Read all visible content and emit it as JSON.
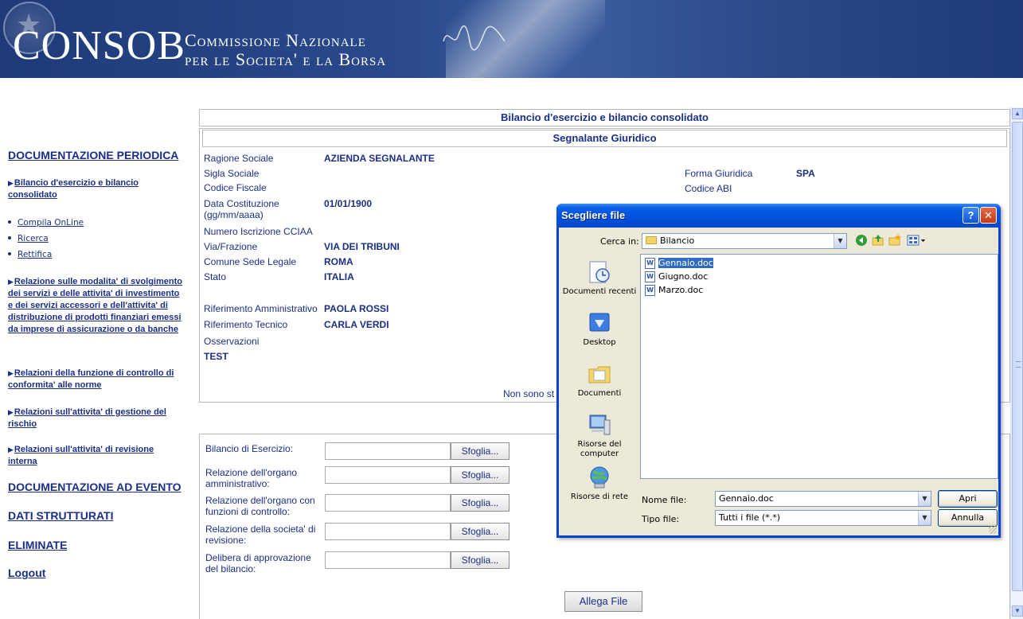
{
  "header": {
    "brand": "CONSOB",
    "tagline_line1": "Commissione Nazionale",
    "tagline_line2": "per le Societa' e la Borsa",
    "colors": {
      "banner": "#2a4a8c",
      "text": "#ffffff"
    }
  },
  "nav": {
    "documentazione_periodica": "DOCUMENTAZIONE PERIODICA",
    "bilancio": "Bilancio d'esercizio e bilancio consolidato",
    "compila": "Compila OnLine",
    "ricerca": "Ricerca",
    "rettifica": "Rettifica",
    "relazione_modalita": "Relazione sulle modalita' di svolgimento dei servizi e delle attivita' di investimento e dei servizi accessori e dell'attivita' di distribuzione di prodotti finanziari emessi da imprese di assicurazione o da banche",
    "relazioni_conformita": "Relazioni della funzione di controllo di conformita' alle norme",
    "relazioni_rischio": "Relazioni sull'attivita' di gestione del rischio",
    "relazioni_revisione": "Relazioni sull'attivita' di revisione interna",
    "documentazione_evento": "DOCUMENTAZIONE AD EVENTO",
    "dati_strutturati": "DATI STRUTTURATI",
    "eliminate": "ELIMINATE",
    "logout": "Logout",
    "colors": {
      "link": "#1a2f86"
    }
  },
  "main": {
    "page_title": "Bilancio d'esercizio e bilancio consolidato",
    "section_title": "Segnalante Giuridico",
    "fields": {
      "ragione_sociale_label": "Ragione Sociale",
      "ragione_sociale_value": "AZIENDA SEGNALANTE",
      "sigla_label": "Sigla Sociale",
      "codice_fiscale_label": "Codice Fiscale",
      "data_costituzione_label": "Data Costituzione (gg/mm/aaaa)",
      "data_costituzione_value": "01/01/1900",
      "numero_cciaa_label": "Numero Iscrizione CCIAA",
      "via_label": "Via/Frazione",
      "via_value": "VIA DEI TRIBUNI",
      "comune_label": "Comune Sede Legale",
      "comune_value": "ROMA",
      "stato_label": "Stato",
      "stato_value": "ITALIA",
      "rif_amm_label": "Riferimento Amministrativo",
      "rif_amm_value": "PAOLA ROSSI",
      "rif_tec_label": "Riferimento Tecnico",
      "rif_tec_value": "CARLA VERDI",
      "osservazioni_label": "Osservazioni",
      "osservazioni_value": "TEST",
      "forma_giuridica_label": "Forma Giuridica",
      "forma_giuridica_value": "SPA",
      "codice_abi_label": "Codice ABI"
    },
    "notice_partial": "Non sono st",
    "uploads": [
      {
        "label": "Bilancio di Esercizio:",
        "button": "Sfoglia..."
      },
      {
        "label": "Relazione dell'organo amministrativo:",
        "button": "Sfoglia..."
      },
      {
        "label": "Relazione dell'organo con funzioni di controllo:",
        "button": "Sfoglia..."
      },
      {
        "label": "Relazione della societa' di revisione:",
        "button": "Sfoglia..."
      },
      {
        "label": "Delibera di approvazione del bilancio:",
        "button": "Sfoglia..."
      }
    ],
    "allega": "Allega File"
  },
  "dialog": {
    "title": "Scegliere file",
    "help_glyph": "?",
    "close_glyph": "✕",
    "cerca_label": "Cerca in:",
    "cerca_value": "Bilancio",
    "places": [
      {
        "label": "Documenti recenti",
        "icon": "recent-documents-icon"
      },
      {
        "label": "Desktop",
        "icon": "desktop-icon"
      },
      {
        "label": "Documenti",
        "icon": "documents-icon"
      },
      {
        "label": "Risorse del computer",
        "icon": "computer-icon"
      },
      {
        "label": "Risorse di rete",
        "icon": "network-icon"
      }
    ],
    "files": [
      {
        "name": "Gennaio.doc",
        "selected": true
      },
      {
        "name": "Giugno.doc",
        "selected": false
      },
      {
        "name": "Marzo.doc",
        "selected": false
      }
    ],
    "nome_file_label": "Nome file:",
    "nome_file_value": "Gennaio.doc",
    "tipo_file_label": "Tipo file:",
    "tipo_file_value": "Tutti i file (*.*)",
    "apri": "Apri",
    "annulla": "Annulla",
    "colors": {
      "titlebar": "#0052df",
      "face": "#ece9d8",
      "selection": "#316ac5"
    }
  }
}
